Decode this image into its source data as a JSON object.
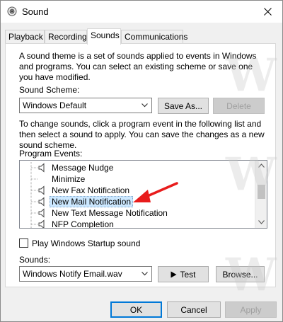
{
  "window": {
    "title": "Sound"
  },
  "tabs": [
    {
      "label": "Playback"
    },
    {
      "label": "Recording"
    },
    {
      "label": "Sounds"
    },
    {
      "label": "Communications"
    }
  ],
  "sounds_tab": {
    "intro": "A sound theme is a set of sounds applied to events in Windows and programs.  You can select an existing scheme or save one you have modified.",
    "scheme_label": "Sound Scheme:",
    "scheme_value": "Windows Default",
    "save_as_label": "Save As...",
    "delete_label": "Delete",
    "instructions": "To change sounds, click a program event in the following list and then select a sound to apply.  You can save the changes as a new sound scheme.",
    "events_label": "Program Events:",
    "events": [
      {
        "label": "Message Nudge",
        "icon": "speaker-icon"
      },
      {
        "label": "Minimize",
        "icon": ""
      },
      {
        "label": "New Fax Notification",
        "icon": "speaker-icon"
      },
      {
        "label": "New Mail Notification",
        "icon": "speaker-icon",
        "selected": true
      },
      {
        "label": "New Text Message Notification",
        "icon": "speaker-icon"
      },
      {
        "label": "NFP Completion",
        "icon": "speaker-icon"
      }
    ],
    "startup_checkbox_label": "Play Windows Startup sound",
    "startup_checked": false,
    "sounds_label": "Sounds:",
    "sounds_value": "Windows Notify Email.wav",
    "test_label": "Test",
    "browse_label": "Browse..."
  },
  "footer": {
    "ok_label": "OK",
    "cancel_label": "Cancel",
    "apply_label": "Apply"
  },
  "watermark": {
    "text": "W"
  },
  "annotation": {
    "arrow_color": "#e81c1c"
  },
  "colors": {
    "accent": "#0078d7",
    "selection": "#cce8ff"
  }
}
